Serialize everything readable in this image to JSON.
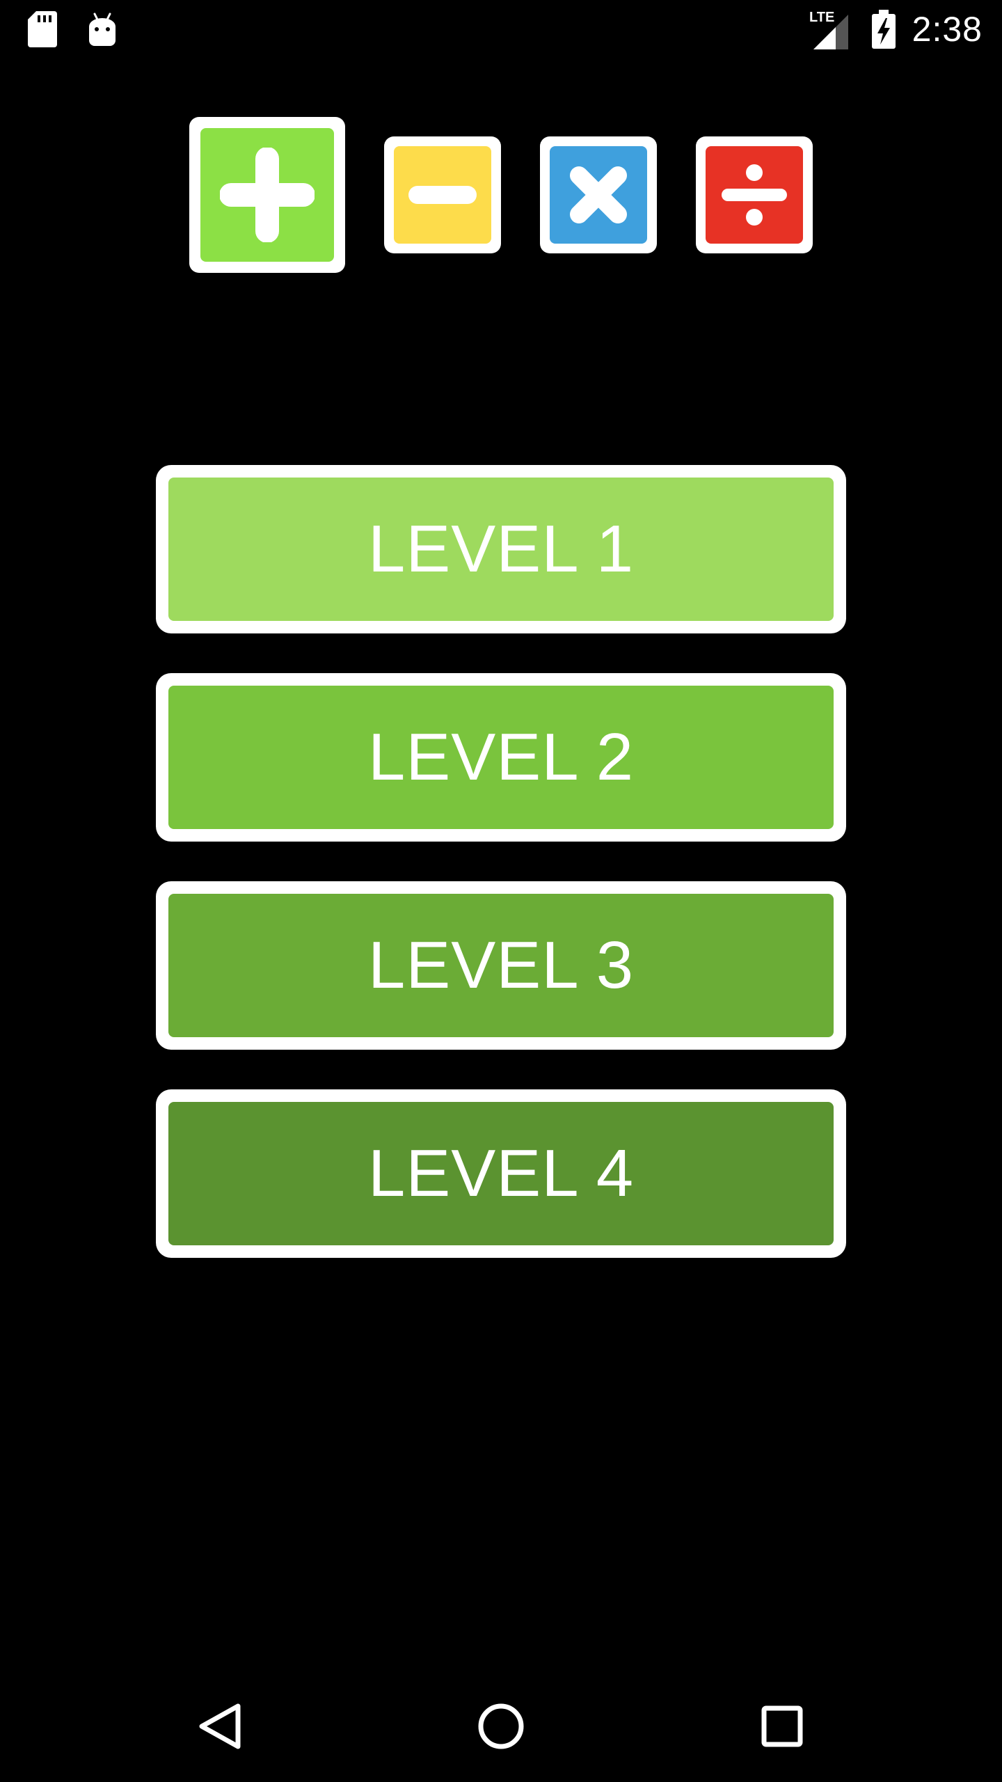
{
  "status_bar": {
    "time": "2:38",
    "network": "LTE",
    "icons": [
      "sd-card-icon",
      "android-icon",
      "lte-signal-icon",
      "battery-charging-icon"
    ]
  },
  "operations": [
    {
      "name": "addition",
      "icon": "plus-icon",
      "color": "#8CE045",
      "selected": true
    },
    {
      "name": "subtraction",
      "icon": "minus-icon",
      "color": "#FDDC4B",
      "selected": false
    },
    {
      "name": "multiplication",
      "icon": "times-icon",
      "color": "#3FA0DD",
      "selected": false
    },
    {
      "name": "division",
      "icon": "divide-icon",
      "color": "#E73225",
      "selected": false
    }
  ],
  "levels": [
    {
      "label": "LEVEL 1",
      "color": "#9EDA5E"
    },
    {
      "label": "LEVEL 2",
      "color": "#7AC43D"
    },
    {
      "label": "LEVEL 3",
      "color": "#6BAC36"
    },
    {
      "label": "LEVEL 4",
      "color": "#5B9330"
    }
  ],
  "nav_bar": {
    "icons": [
      "back-icon",
      "home-icon",
      "recent-apps-icon"
    ]
  }
}
